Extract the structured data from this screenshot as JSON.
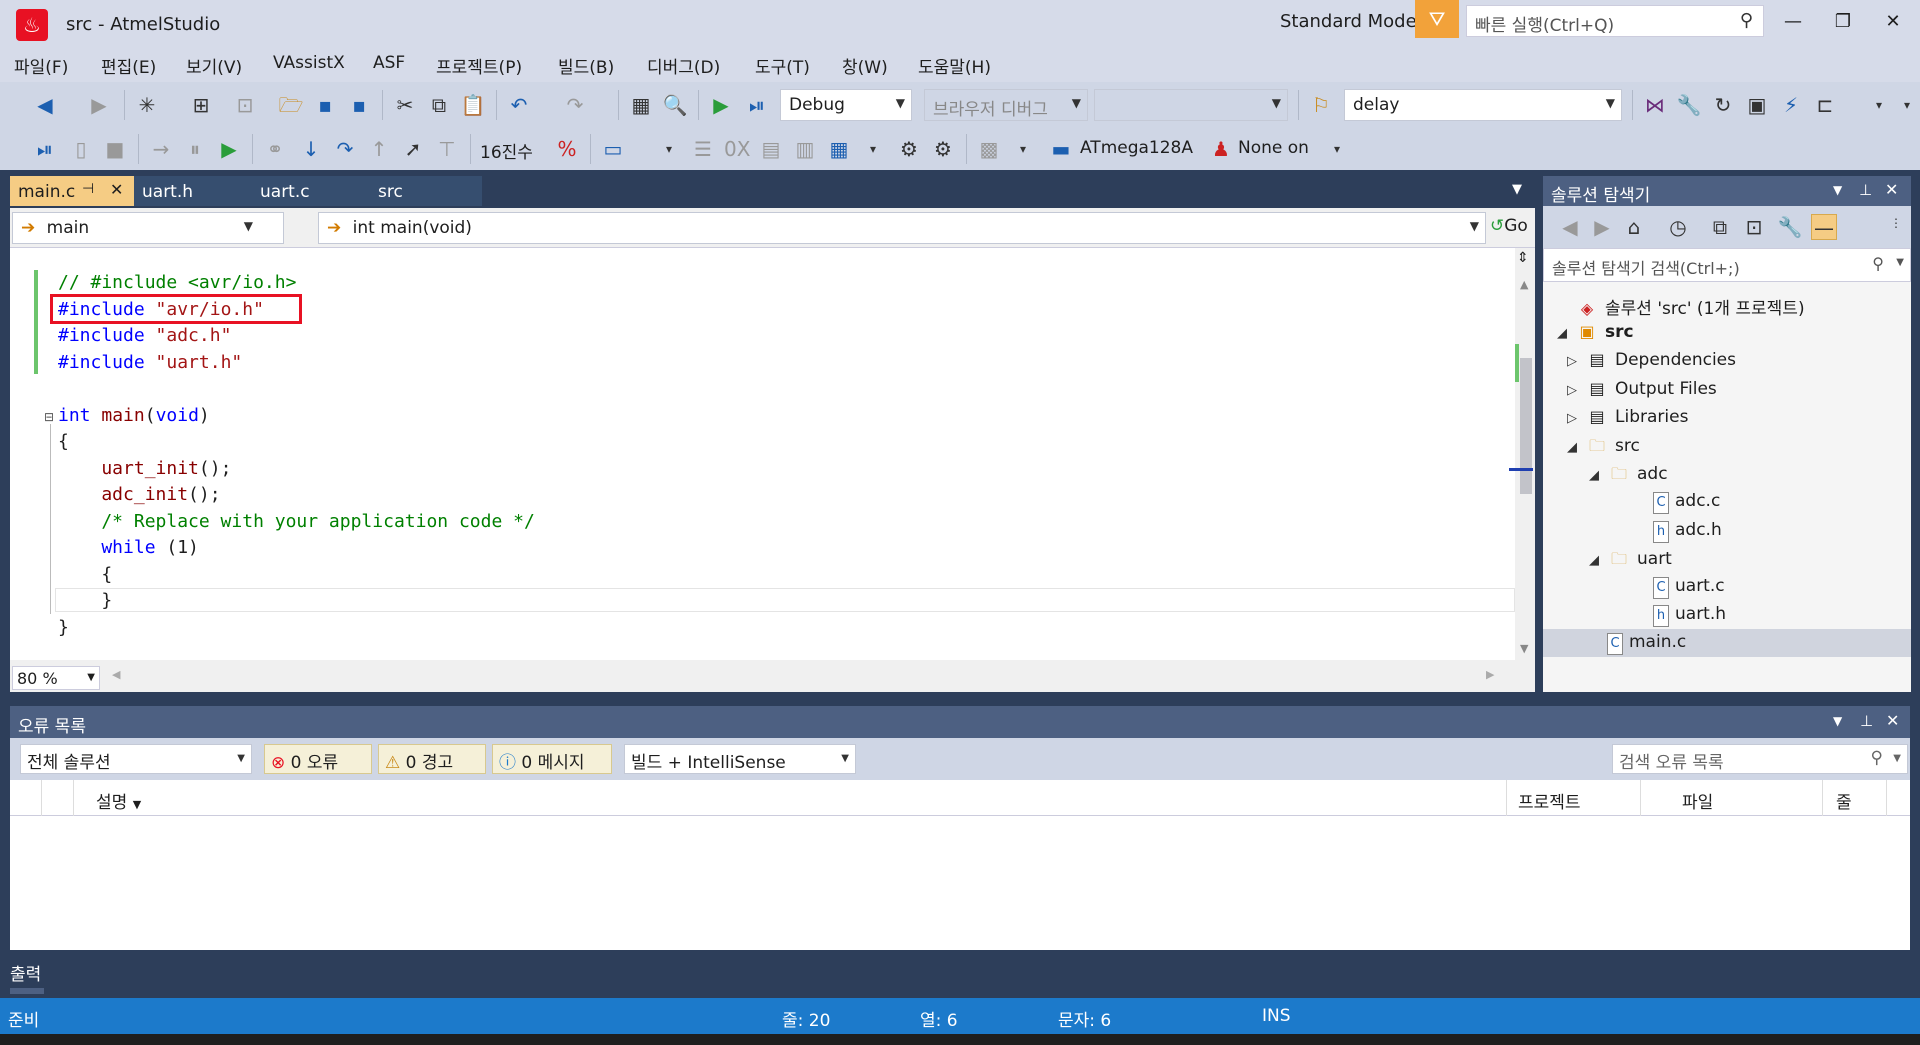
{
  "window": {
    "title": "src - AtmelStudio",
    "mode": "Standard Mode",
    "quick_launch_placeholder": "빠른 실행(Ctrl+Q)"
  },
  "menu": [
    "파일(F)",
    "편집(E)",
    "보기(V)",
    "VAssistX",
    "ASF",
    "프로젝트(P)",
    "빌드(B)",
    "디버그(D)",
    "도구(T)",
    "창(W)",
    "도움말(H)"
  ],
  "toolbar": {
    "config": "Debug",
    "browser_debug": "브라우저 디버그",
    "search_combo": "delay",
    "hex_label": "16진수",
    "device": "ATmega128A",
    "tool": "None on"
  },
  "tabs": [
    "main.c",
    "uart.h",
    "uart.c",
    "src"
  ],
  "navbar": {
    "scope": "main",
    "member": "int main(void)",
    "go": "Go"
  },
  "editor": {
    "zoom": "80 %",
    "lines": [
      [
        {
          "t": "// #include <avr/io.h>",
          "c": "cm"
        }
      ],
      [
        {
          "t": "#include ",
          "c": "kw"
        },
        {
          "t": "\"avr/io.h\"",
          "c": "st"
        }
      ],
      [
        {
          "t": "#include ",
          "c": "kw"
        },
        {
          "t": "\"adc.h\"",
          "c": "st"
        }
      ],
      [
        {
          "t": "#include ",
          "c": "kw"
        },
        {
          "t": "\"uart.h\"",
          "c": "st"
        }
      ],
      [],
      [
        {
          "t": "int ",
          "c": "kw"
        },
        {
          "t": "main",
          "c": "fn"
        },
        {
          "t": "(",
          "c": ""
        },
        {
          "t": "void",
          "c": "kw"
        },
        {
          "t": ")",
          "c": ""
        }
      ],
      [
        {
          "t": "{",
          "c": ""
        }
      ],
      [
        {
          "t": "    uart_init",
          "c": "fn"
        },
        {
          "t": "();",
          "c": ""
        }
      ],
      [
        {
          "t": "    adc_init",
          "c": "fn"
        },
        {
          "t": "();",
          "c": ""
        }
      ],
      [
        {
          "t": "    /* Replace with your application code */",
          "c": "cm"
        }
      ],
      [
        {
          "t": "    while",
          "c": "kw"
        },
        {
          "t": " (1)",
          "c": ""
        }
      ],
      [
        {
          "t": "    {",
          "c": ""
        }
      ],
      [
        {
          "t": "    }",
          "c": ""
        }
      ],
      [
        {
          "t": "}",
          "c": ""
        }
      ]
    ]
  },
  "solution_explorer": {
    "title": "솔루션 탐색기",
    "search_placeholder": "솔루션 탐색기 검색(Ctrl+;)",
    "tree": [
      {
        "label": "솔루션 'src' (1개 프로젝트)",
        "icon": "solution-icon",
        "glyph": "◈",
        "depth": 0,
        "twisty": ""
      },
      {
        "label": "src",
        "icon": "project-icon",
        "glyph": "▣",
        "depth": 0,
        "twisty": "◢",
        "bold": true
      },
      {
        "label": "Dependencies",
        "icon": "dependencies-icon",
        "glyph": "▤",
        "depth": 1,
        "twisty": "▷"
      },
      {
        "label": "Output Files",
        "icon": "output-files-icon",
        "glyph": "▤",
        "depth": 1,
        "twisty": "▷"
      },
      {
        "label": "Libraries",
        "icon": "libraries-icon",
        "glyph": "▤",
        "depth": 1,
        "twisty": "▷"
      },
      {
        "label": "src",
        "icon": "folder-open-icon",
        "glyph": "🗀",
        "depth": 1,
        "twisty": "◢"
      },
      {
        "label": "adc",
        "icon": "folder-open-icon",
        "glyph": "🗀",
        "depth": 2,
        "twisty": "◢"
      },
      {
        "label": "adc.c",
        "icon": "c-file-icon",
        "glyph": "C",
        "depth": 3,
        "twisty": ""
      },
      {
        "label": "adc.h",
        "icon": "h-file-icon",
        "glyph": "h",
        "depth": 3,
        "twisty": ""
      },
      {
        "label": "uart",
        "icon": "folder-open-icon",
        "glyph": "🗀",
        "depth": 2,
        "twisty": "◢"
      },
      {
        "label": "uart.c",
        "icon": "c-file-icon",
        "glyph": "C",
        "depth": 3,
        "twisty": ""
      },
      {
        "label": "uart.h",
        "icon": "h-file-icon",
        "glyph": "h",
        "depth": 3,
        "twisty": ""
      },
      {
        "label": "main.c",
        "icon": "c-file-icon",
        "glyph": "C",
        "depth": 2,
        "twisty": "",
        "selected": true
      }
    ]
  },
  "error_list": {
    "title": "오류 목록",
    "scope": "전체 솔루션",
    "errors": "0 오류",
    "warnings": "0 경고",
    "messages": "0 메시지",
    "source": "빌드 + IntelliSense",
    "search_placeholder": "검색 오류 목록",
    "columns": [
      "설명",
      "프로젝트",
      "파일",
      "줄"
    ]
  },
  "output_label": "출력",
  "status": {
    "ready": "준비",
    "line": "줄: 20",
    "col": "열: 6",
    "char": "문자: 6",
    "ins": "INS"
  },
  "colors": {
    "accent": "#1c7acb",
    "frame": "#2d3e5a",
    "tab_active": "#f5cc84",
    "highlight_box": "#e81123"
  }
}
